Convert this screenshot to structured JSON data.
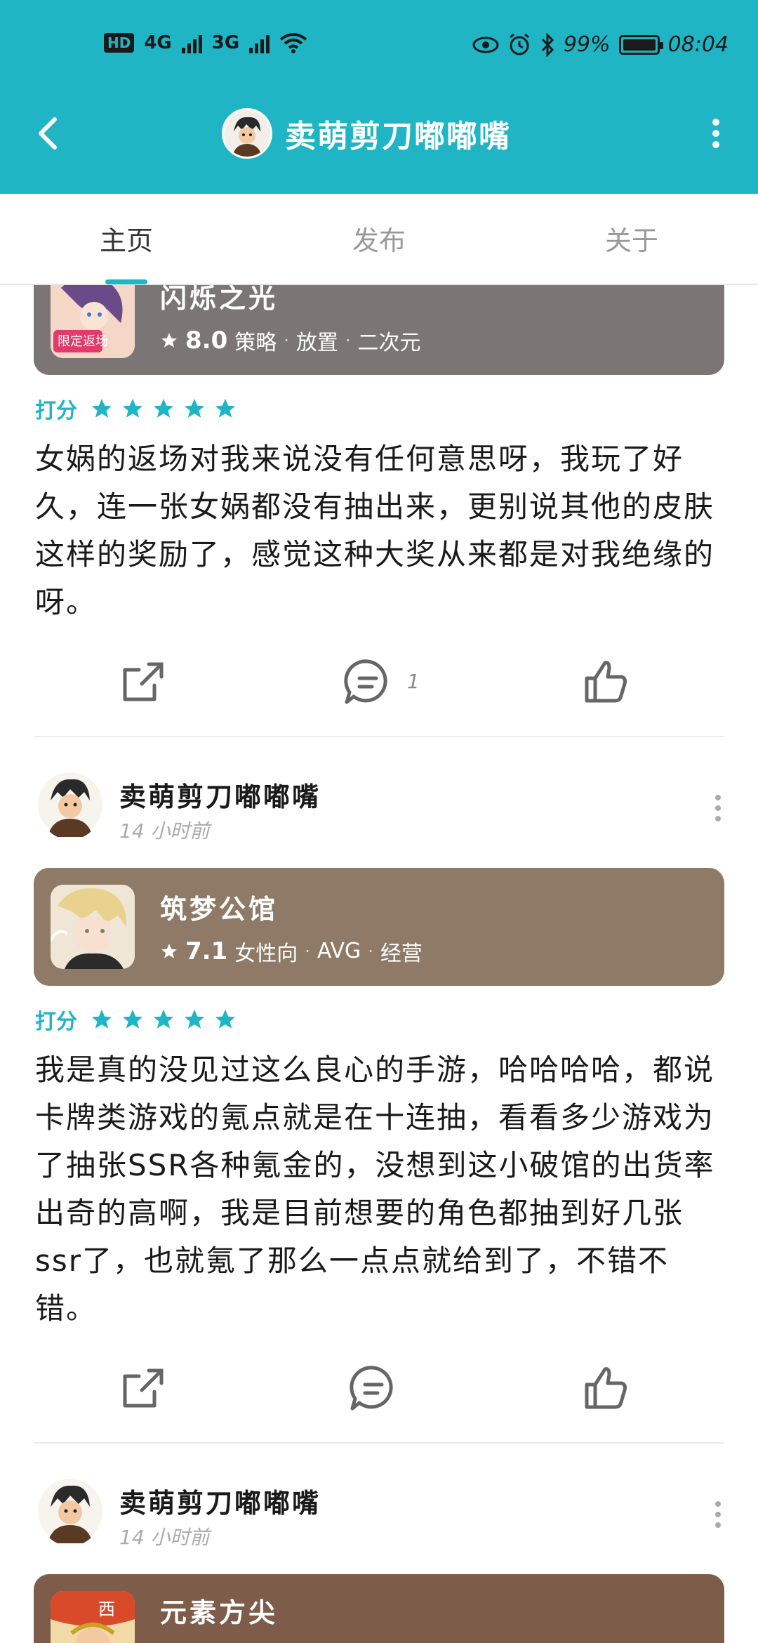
{
  "statusbar": {
    "hd": "HD",
    "net1": "4G",
    "net2": "3G",
    "battery_text": "99%",
    "time": "08:04"
  },
  "header": {
    "title": "卖萌剪刀嘟嘟嘴",
    "back_icon": "back-arrow-icon",
    "more_icon": "more-vertical-icon"
  },
  "tabs": [
    {
      "label": "主页",
      "active": true
    },
    {
      "label": "发布",
      "active": false
    },
    {
      "label": "关于",
      "active": false
    }
  ],
  "posts": [
    {
      "game": {
        "name": "闪烁之光",
        "score": "8.0",
        "tags": [
          "策略",
          "放置",
          "二次元"
        ],
        "card_color": "#7b7675"
      },
      "rating_label": "打分",
      "stars": 5,
      "review": "女娲的返场对我来说没有任何意思呀，我玩了好久，连一张女娲都没有抽出来，更别说其他的皮肤这样的奖励了，感觉这种大奖从来都是对我绝缘的呀。",
      "comment_count": "1"
    },
    {
      "user": "卖萌剪刀嘟嘟嘴",
      "time": "14 小时前",
      "game": {
        "name": "筑梦公馆",
        "score": "7.1",
        "tags": [
          "女性向",
          "AVG",
          "经营"
        ],
        "card_color": "#8e7a66"
      },
      "rating_label": "打分",
      "stars": 5,
      "review": "我是真的没见过这么良心的手游，哈哈哈哈，都说卡牌类游戏的氪点就是在十连抽，看看多少游戏为了抽张SSR各种氪金的，没想到这小破馆的出货率出奇的高啊，我是目前想要的角色都抽到好几张ssr了，也就氪了那么一点点就给到了，不错不错。",
      "comment_count": ""
    },
    {
      "user": "卖萌剪刀嘟嘟嘴",
      "time": "14 小时前",
      "game": {
        "name": "元素方尖",
        "card_color": "#7d5c4a"
      }
    }
  ]
}
